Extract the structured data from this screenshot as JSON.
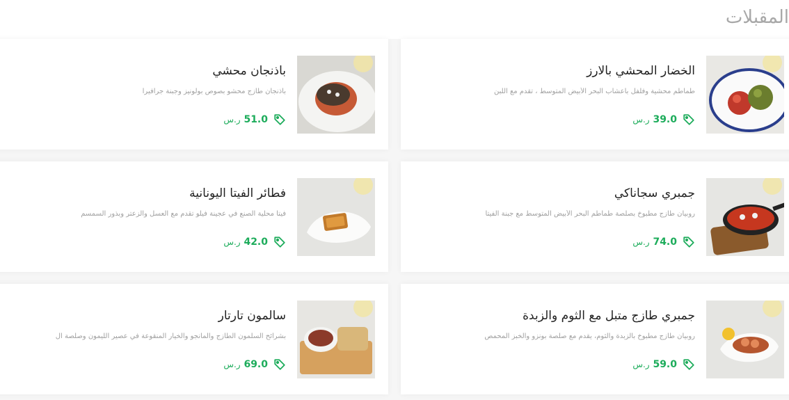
{
  "section": {
    "title": "المقبلات"
  },
  "colors": {
    "price": "#1dac5b",
    "title": "#a8a8a8"
  },
  "items": [
    {
      "name": "الخضار المحشي بالارز",
      "desc": "طماطم محشية وفلفل بأعشاب البحر الأبيض المتوسط ، تقدم مع اللبن",
      "price": "39.0",
      "currency": "ر.س",
      "icon": "tag-icon",
      "image": "stuffed-vegetables-plate"
    },
    {
      "name": "باذنجان محشي",
      "desc": "باذنجان طازج محشو بصوص بولونيز وجبنة جرافيرا",
      "price": "51.0",
      "currency": "ر.س",
      "icon": "tag-icon",
      "image": "stuffed-eggplant-plate"
    },
    {
      "name": "جمبري سجاناكي",
      "desc": "روبيان طازج مطبوخ بصلصة طماطم البحر الأبيض المتوسط مع جبنة الفيتا",
      "price": "74.0",
      "currency": "ر.س",
      "icon": "tag-icon",
      "image": "shrimp-saganaki-pan"
    },
    {
      "name": "فطائر الفيتا اليونانية",
      "desc": "فيتا محلية الصنع في عجينة فيلو تقدم مع العسل والزعتر وبذور السمسم",
      "price": "42.0",
      "currency": "ر.س",
      "icon": "tag-icon",
      "image": "feta-pastry-plate"
    },
    {
      "name": "جمبري طازج متبل مع الثوم والزبدة",
      "desc": "روبيان طازج مطبوخ بالزبدة والثوم، يقدم مع صلصة بونزو والخبز المحمص",
      "price": "59.0",
      "currency": "ر.س",
      "icon": "tag-icon",
      "image": "garlic-butter-shrimp-plate"
    },
    {
      "name": "سالمون تارتار",
      "desc": "بشرائح السلمون الطازج والمانجو والخيار المنقوعة في عصير الليمون وصلصة ال",
      "price": "69.0",
      "currency": "ر.س",
      "icon": "tag-icon",
      "image": "salmon-tartare-bowl"
    }
  ]
}
